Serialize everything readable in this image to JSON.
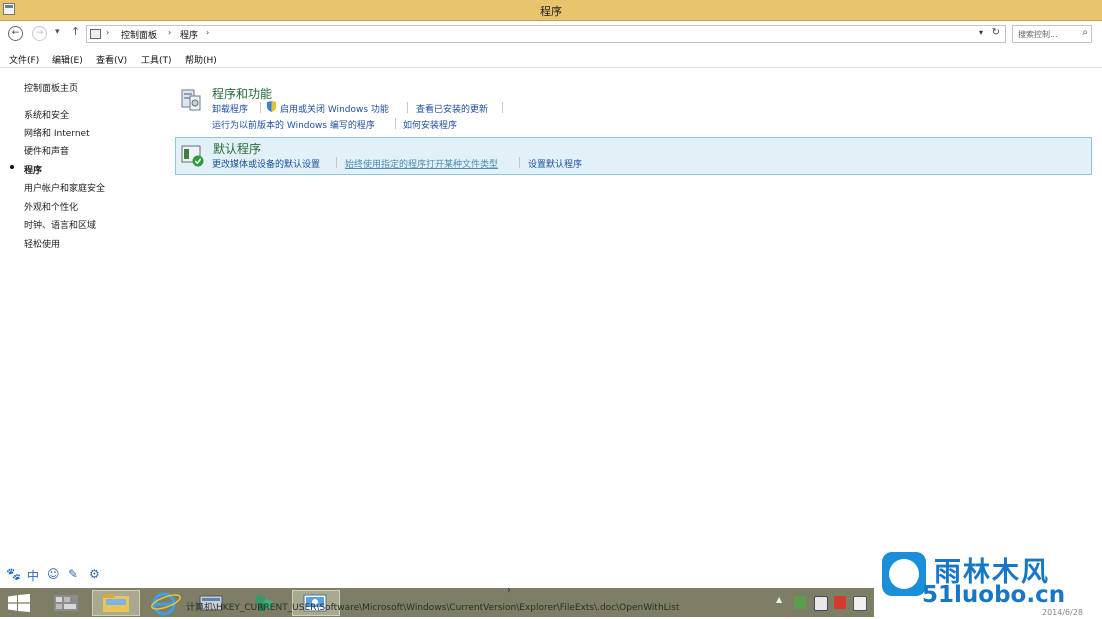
{
  "window": {
    "title": "程序"
  },
  "address": {
    "back": "←",
    "forward": "→",
    "recent": "▾",
    "up": "↑",
    "breadcrumbs": [
      "控制面板",
      "程序"
    ],
    "separator": "›",
    "dropdown": "▾",
    "refresh": "↻"
  },
  "search": {
    "placeholder": "搜索控制...",
    "icon": "⌕"
  },
  "menubar": [
    "文件(F)",
    "编辑(E)",
    "查看(V)",
    "工具(T)",
    "帮助(H)"
  ],
  "sidebar": {
    "home": "控制面板主页",
    "items": [
      "系统和安全",
      "网络和 Internet",
      "硬件和声音",
      "程序",
      "用户帐户和家庭安全",
      "外观和个性化",
      "时钟、语言和区域",
      "轻松使用"
    ],
    "current_index": 3
  },
  "categories": [
    {
      "title": "程序和功能",
      "row1": [
        "卸载程序",
        "启用或关闭 Windows 功能",
        "查看已安装的更新"
      ],
      "row2": [
        "运行为以前版本的 Windows 编写的程序",
        "如何安装程序"
      ]
    },
    {
      "title": "默认程序",
      "row1": [
        "更改媒体或设备的默认设置",
        "始终使用指定的程序打开某种文件类型",
        "设置默认程序"
      ]
    }
  ],
  "ime_bar": [
    "🐾",
    "中",
    "☺",
    "✎",
    "⚙"
  ],
  "taskbar": {
    "status_text": "计算机\\HKEY_CURRENT_USER\\Software\\Microsoft\\Windows\\CurrentVersion\\Explorer\\FileExts\\.doc\\OpenWithList",
    "scroll_glyph": "›"
  },
  "watermark": {
    "chinese": "雨林木风",
    "domain": "51luobo.cn",
    "clock_date": "2014/6/28"
  },
  "colors": {
    "titlebar": "#e8c46c",
    "taskbar": "#7e7e66",
    "link": "#1e4fa3",
    "category_title": "#26683a",
    "highlight": "#e2f1f7"
  }
}
